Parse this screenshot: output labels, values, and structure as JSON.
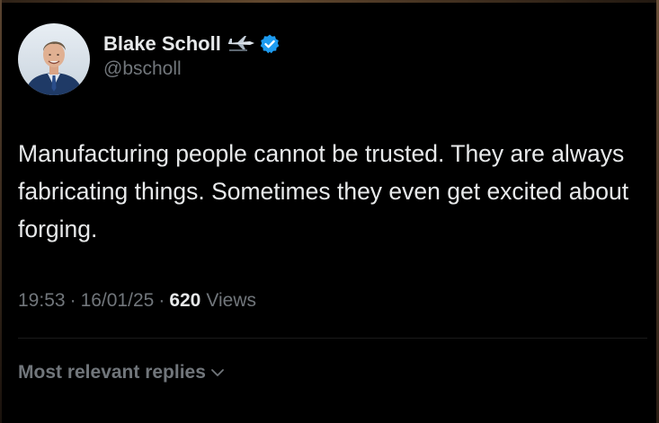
{
  "author": {
    "display_name": "Blake Scholl",
    "handle": "@bscholl",
    "verified": true,
    "badge_icon": "plane-icon",
    "verified_icon": "verified-icon",
    "verified_color": "#1d9bf0"
  },
  "tweet": {
    "text": "Manufacturing people cannot be trusted. They are always fabricating things. Sometimes they even get excited about forging."
  },
  "meta": {
    "time": "19:53",
    "date": "16/01/25",
    "separator": "·",
    "views_count": "620",
    "views_label": "Views"
  },
  "replies": {
    "sort_label": "Most relevant replies",
    "sort_icon": "chevron-down-icon"
  },
  "colors": {
    "background": "#000000",
    "primary_text": "#e7e9ea",
    "secondary_text": "#71767b",
    "accent": "#1d9bf0"
  }
}
